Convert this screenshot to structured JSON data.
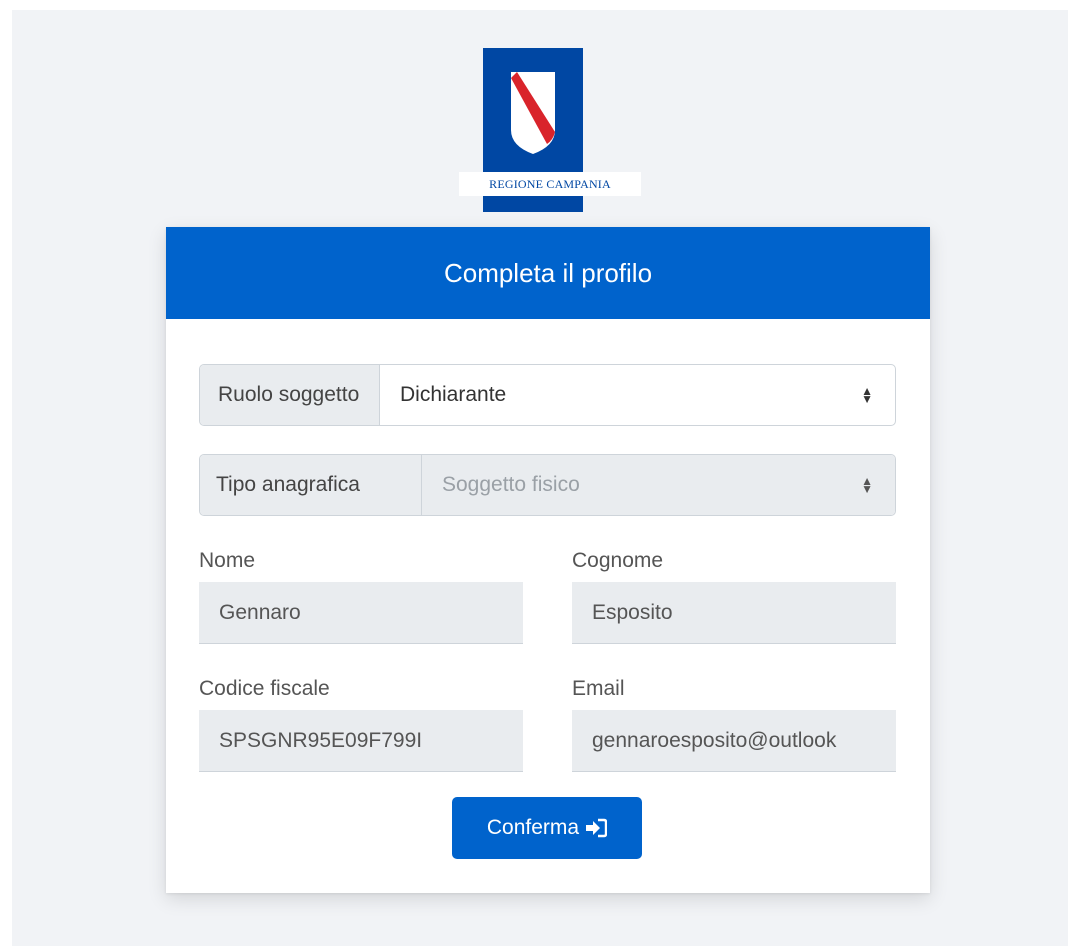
{
  "logo": {
    "text": "REGIONE CAMPANIA"
  },
  "card": {
    "title": "Completa il profilo"
  },
  "ruolo": {
    "label": "Ruolo soggetto",
    "value": "Dichiarante"
  },
  "tipo": {
    "label": "Tipo anagrafica",
    "value": "Soggetto fisico"
  },
  "nome": {
    "label": "Nome",
    "value": "Gennaro"
  },
  "cognome": {
    "label": "Cognome",
    "value": "Esposito"
  },
  "codice_fiscale": {
    "label": "Codice fiscale",
    "value": "SPSGNR95E09F799I"
  },
  "email": {
    "label": "Email",
    "value": "gennaroesposito@outlook"
  },
  "confirm": {
    "label": "Conferma",
    "icon": "sign-in-icon"
  },
  "colors": {
    "primary": "#0063cc",
    "logo_blue": "#0047a3",
    "stripe_red": "#d9242b",
    "page_bg": "#f1f3f6"
  }
}
